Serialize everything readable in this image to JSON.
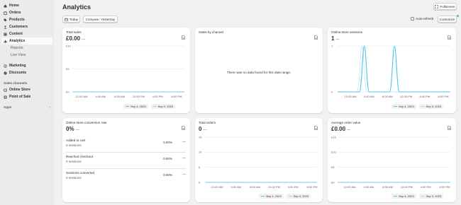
{
  "sidebar": {
    "items": [
      {
        "label": "Home",
        "icon": "home-icon"
      },
      {
        "label": "Orders",
        "icon": "orders-icon"
      },
      {
        "label": "Products",
        "icon": "tag-icon"
      },
      {
        "label": "Customers",
        "icon": "person-icon"
      },
      {
        "label": "Content",
        "icon": "content-icon"
      },
      {
        "label": "Analytics",
        "icon": "chart-icon"
      },
      {
        "label": "Reports"
      },
      {
        "label": "Live View"
      },
      {
        "label": "Marketing",
        "icon": "target-icon"
      },
      {
        "label": "Discounts",
        "icon": "discount-icon"
      }
    ],
    "sales_channels_label": "Sales channels",
    "channels": [
      {
        "label": "Online Store",
        "icon": "store-icon"
      },
      {
        "label": "Point of Sale",
        "icon": "pos-icon"
      }
    ],
    "apps_label": "Apps",
    "apps_chevron": "›"
  },
  "header": {
    "title": "Analytics",
    "fullscreen_label": "Fullscreen",
    "today_label": "Today",
    "compare_label": "Compare: Yesterday",
    "autorefresh_label": "Auto-refresh",
    "customize_label": "Customize"
  },
  "legend": {
    "current": "Sep 4, 2023",
    "previous": "Sep 3, 2023"
  },
  "cards": {
    "total_sales": {
      "title": "Total sales",
      "value": "£0.00",
      "dash": "—"
    },
    "sales_by_channel": {
      "title": "Sales by channel",
      "no_data": "There was no data found for this date range."
    },
    "sessions": {
      "title": "Online store sessions",
      "value": "1",
      "dash": "—"
    },
    "conversion": {
      "title": "Online store conversion rate",
      "value": "0%",
      "dash": "—",
      "rows": [
        {
          "label": "Added to cart",
          "sub": "0 sessions",
          "pct": "0.00%",
          "dash": "—"
        },
        {
          "label": "Reached checkout",
          "sub": "0 sessions",
          "pct": "0.00%",
          "dash": "—"
        },
        {
          "label": "Sessions converted",
          "sub": "0 sessions",
          "pct": "0.00%",
          "dash": "—"
        }
      ]
    },
    "total_orders": {
      "title": "Total orders",
      "value": "0",
      "dash": "—"
    },
    "aov": {
      "title": "Average order value",
      "value": "£0.00",
      "dash": "—"
    }
  },
  "colors": {
    "current": "#4fc3e8",
    "previous": "#9bd9ee",
    "grid": "#e3e3e3"
  },
  "chart_data": [
    {
      "type": "line",
      "name": "total_sales",
      "x": [
        "12:00 AM",
        "4:00 AM",
        "8:00 AM",
        "12:00 PM",
        "4:00 PM",
        "8:00 PM"
      ],
      "yticks": [
        "£10",
        "£5",
        "£0"
      ],
      "ylim": [
        0,
        10
      ],
      "series": [
        {
          "name": "Sep 4, 2023",
          "values": [
            0,
            0,
            0,
            0,
            0,
            0
          ]
        },
        {
          "name": "Sep 3, 2023",
          "values": [
            0,
            0,
            0,
            0,
            0,
            0
          ]
        }
      ]
    },
    {
      "type": "line",
      "name": "sessions",
      "x": [
        "12:00 AM",
        "4:00 AM",
        "8:00 AM",
        "12:00 PM",
        "4:00 PM",
        "8:00 PM"
      ],
      "yticks": [
        "1",
        "0"
      ],
      "ylim": [
        0,
        1
      ],
      "series": [
        {
          "name": "Sep 4, 2023",
          "peaks": [
            {
              "hour": 3,
              "value": 1
            },
            {
              "hour": 9.5,
              "value": 1
            }
          ]
        },
        {
          "name": "Sep 3, 2023",
          "peaks": [
            {
              "hour": 2.5,
              "value": 1
            }
          ]
        }
      ]
    },
    {
      "type": "line",
      "name": "total_orders",
      "x": [
        "12:00 AM",
        "4:00 AM",
        "8:00 AM",
        "12:00 PM",
        "4:00 PM",
        "8:00 PM"
      ],
      "yticks": [
        "15",
        "10",
        "5",
        "0"
      ],
      "ylim": [
        0,
        15
      ],
      "series": [
        {
          "name": "Sep 4, 2023",
          "values": [
            0,
            0,
            0,
            0,
            0,
            0
          ]
        },
        {
          "name": "Sep 3, 2023",
          "values": [
            0,
            0,
            0,
            0,
            0,
            0
          ]
        }
      ]
    },
    {
      "type": "line",
      "name": "aov",
      "x": [
        "12:00 AM",
        "4:00 AM",
        "8:00 AM",
        "12:00 PM",
        "4:00 PM",
        "8:00 PM"
      ],
      "yticks": [
        "£15",
        "£10",
        "£5",
        "£0"
      ],
      "ylim": [
        0,
        15
      ],
      "series": [
        {
          "name": "Sep 4, 2023",
          "values": [
            0,
            0,
            0,
            0,
            0,
            0
          ]
        },
        {
          "name": "Sep 3, 2023",
          "values": [
            0,
            0,
            0,
            0,
            0,
            0
          ]
        }
      ]
    }
  ]
}
